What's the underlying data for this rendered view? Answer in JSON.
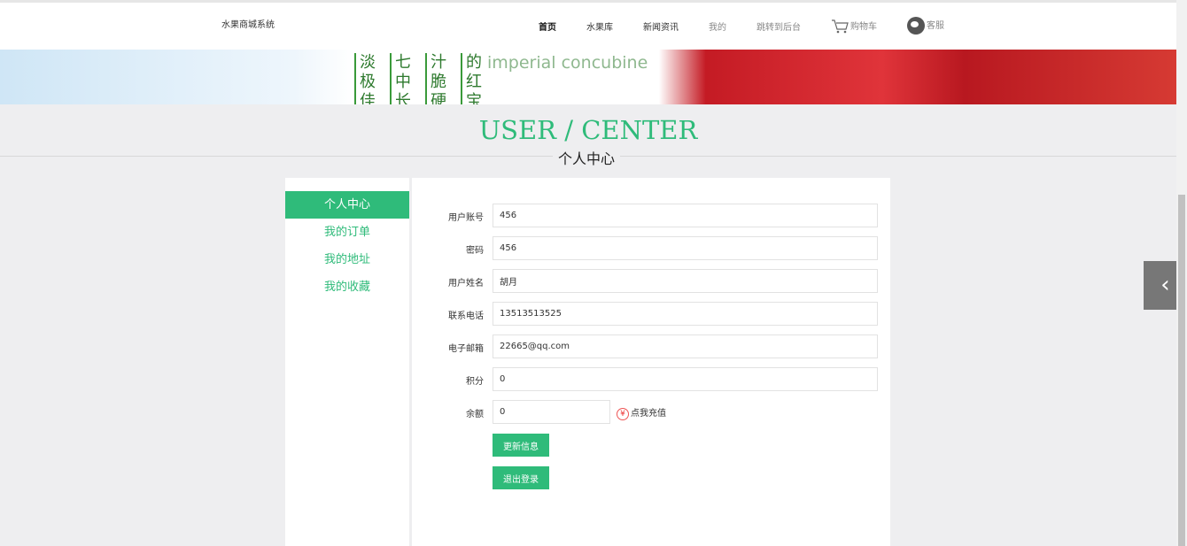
{
  "header": {
    "brand": "水果商城系统",
    "nav": [
      {
        "label": "首页"
      },
      {
        "label": "水果库"
      },
      {
        "label": "新闻资讯"
      },
      {
        "label": "我的"
      },
      {
        "label": "跳转到后台"
      }
    ],
    "cart": "购物车",
    "service": "客服"
  },
  "banner": {
    "columns": [
      "淡极佳",
      "七中长",
      "汁脆硬",
      "的红宝"
    ],
    "tagline": "imperial concubine"
  },
  "page": {
    "title_en": "USER / CENTER",
    "title_cn": "个人中心"
  },
  "sidebar": {
    "items": [
      {
        "label": "个人中心",
        "active": true
      },
      {
        "label": "我的订单"
      },
      {
        "label": "我的地址"
      },
      {
        "label": "我的收藏"
      }
    ]
  },
  "form": {
    "fields": [
      {
        "label": "用户账号",
        "value": "456"
      },
      {
        "label": "密码",
        "value": "456"
      },
      {
        "label": "用户姓名",
        "value": "胡月"
      },
      {
        "label": "联系电话",
        "value": "13513513525"
      },
      {
        "label": "电子邮箱",
        "value": "22665@qq.com"
      },
      {
        "label": "积分",
        "value": "0"
      },
      {
        "label": "余额",
        "value": "0"
      }
    ],
    "recharge": "点我充值",
    "update_button": "更新信息",
    "logout_button": "退出登录"
  },
  "colors": {
    "accent": "#2fbb7a"
  }
}
